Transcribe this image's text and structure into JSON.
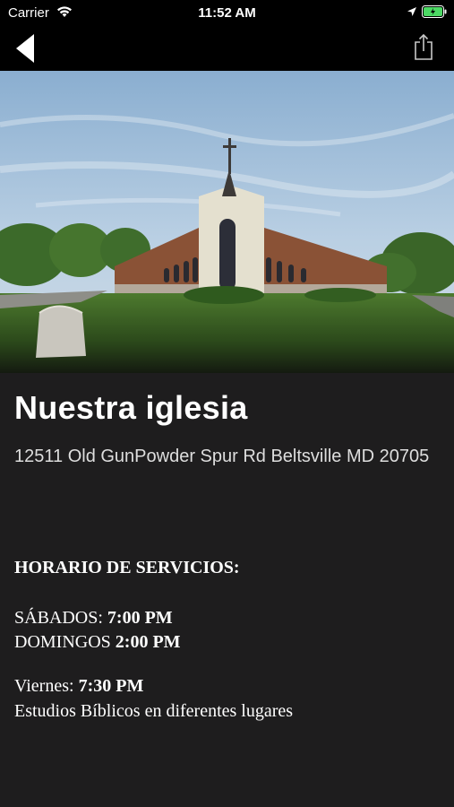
{
  "status_bar": {
    "carrier": "Carrier",
    "time": "11:52 AM"
  },
  "nav": {
    "back_icon": "back-chevron-icon",
    "share_icon": "share-icon"
  },
  "hero": {
    "image_alt": "church-photo"
  },
  "page": {
    "title": "Nuestra iglesia",
    "address": "12511 Old GunPowder Spur Rd Beltsville MD 20705"
  },
  "schedule": {
    "heading": "HORARIO DE SERVICIOS:",
    "saturday_label": "SÁBADOS:",
    "saturday_time": "7:00 PM",
    "sunday_label": "DOMINGOS",
    "sunday_time": "2:00 PM",
    "friday_label": "Viernes:",
    "friday_time": "7:30 PM",
    "friday_note": "Estudios Bíblicos en diferentes lugares"
  },
  "colors": {
    "background": "#1e1d1e",
    "bar": "#000000",
    "battery": "#4cd964"
  }
}
